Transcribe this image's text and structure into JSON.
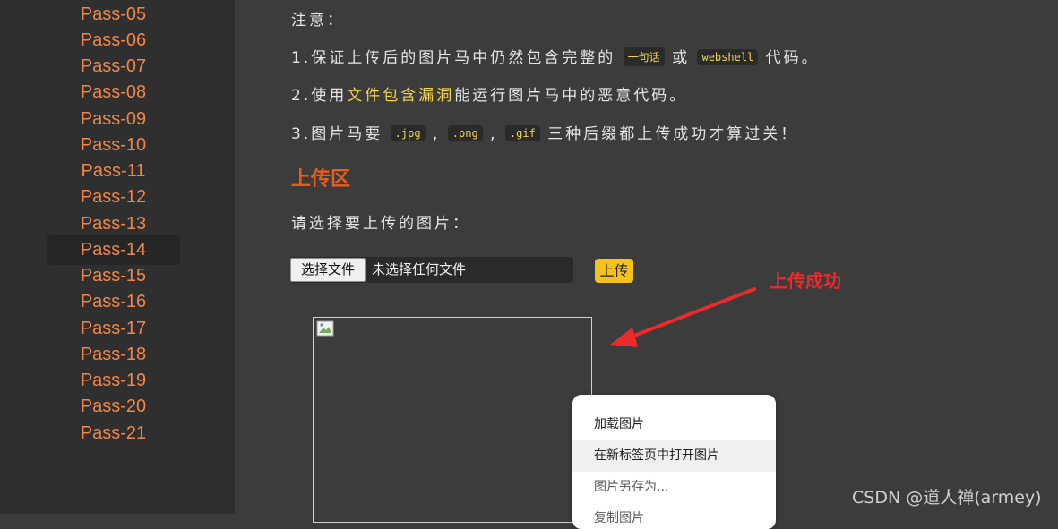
{
  "sidebar": {
    "items": [
      "Pass-05",
      "Pass-06",
      "Pass-07",
      "Pass-08",
      "Pass-09",
      "Pass-10",
      "Pass-11",
      "Pass-12",
      "Pass-13",
      "Pass-14",
      "Pass-15",
      "Pass-16",
      "Pass-17",
      "Pass-18",
      "Pass-19",
      "Pass-20",
      "Pass-21"
    ],
    "active": "Pass-14"
  },
  "notice": {
    "heading": "注意：",
    "line1": {
      "prefix": "1.保证上传后的图片马中仍然包含完整的",
      "code1": "一句话",
      "mid": "或",
      "code2": "webshell",
      "suffix": "代码。"
    },
    "line2": {
      "prefix": "2.使用",
      "highlight": "文件包含漏洞",
      "suffix": "能运行图片马中的恶意代码。"
    },
    "line3": {
      "prefix": "3.图片马要",
      "code1": ".jpg",
      "sep1": ",",
      "code2": ".png",
      "sep2": ",",
      "code3": ".gif",
      "suffix": "三种后缀都上传成功才算过关！"
    }
  },
  "upload_section": {
    "title": "上传区",
    "prompt": "请选择要上传的图片：",
    "file_button": "选择文件",
    "file_status": "未选择任何文件",
    "upload_button": "上传"
  },
  "annotation": {
    "text": "上传成功",
    "color": "#ec2a2a"
  },
  "context_menu": {
    "items": [
      "加载图片",
      "在新标签页中打开图片",
      "图片另存为...",
      "复制图片"
    ]
  },
  "watermark": "CSDN @道人禅(armey)",
  "colors": {
    "accent_orange": "#f0864a",
    "title_orange": "#e85d18",
    "highlight_yellow": "#f3d54e",
    "button_yellow": "#f4c21b"
  }
}
